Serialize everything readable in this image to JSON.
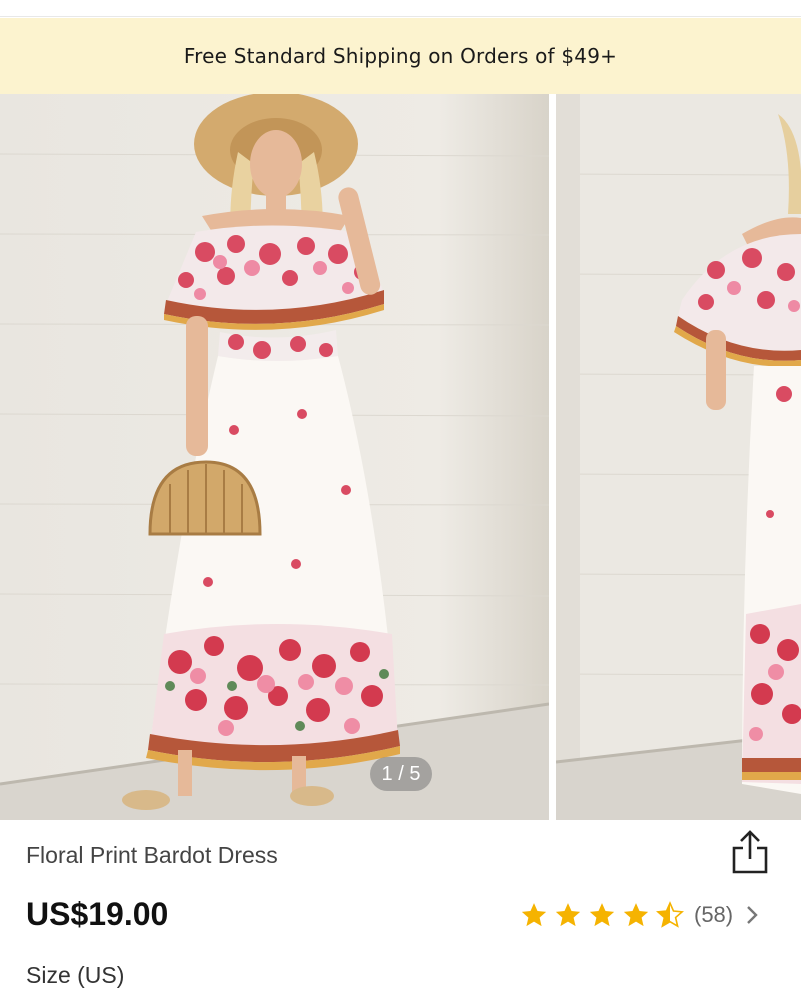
{
  "promo": {
    "text": "Free Standard Shipping on Orders of $49+"
  },
  "gallery": {
    "counter": "1 / 5",
    "current": 1,
    "total": 5
  },
  "product": {
    "title": "Floral Print Bardot Dress",
    "price": "US$19.00",
    "rating": 4.5,
    "review_count": "(58)",
    "size_label": "Size (US)"
  },
  "icons": {
    "share": "share-icon",
    "star": "star-icon",
    "chevron": "chevron-right-icon"
  },
  "colors": {
    "banner_bg": "#fcf3cf",
    "star": "#f5b301",
    "price": "#111111"
  }
}
